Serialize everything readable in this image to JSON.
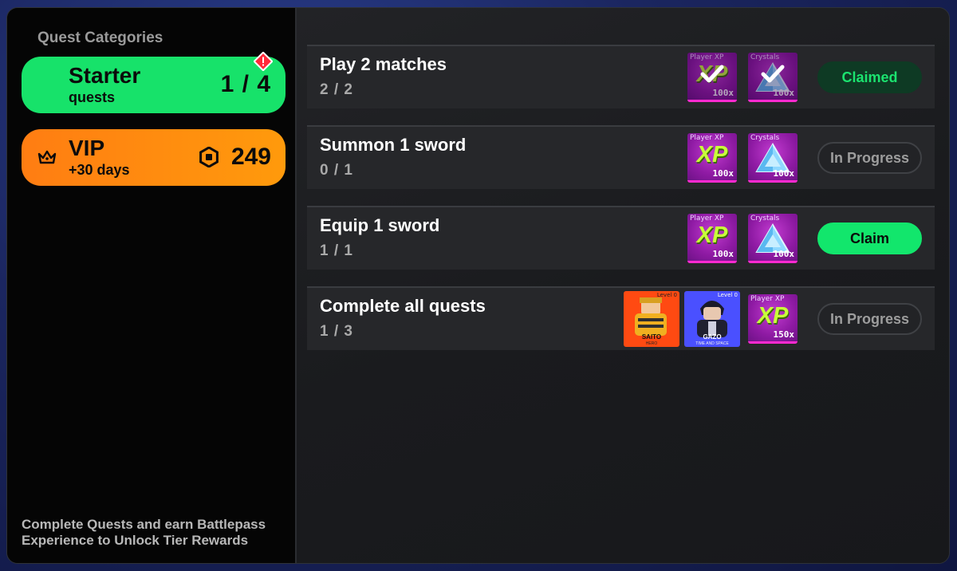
{
  "sidebar": {
    "title": "Quest Categories",
    "categories": [
      {
        "title": "Starter",
        "subtitle": "quests",
        "count": "1 / 4",
        "icon": "alert-icon"
      },
      {
        "title": "VIP",
        "subtitle": "+30 days",
        "amount": "249",
        "icon": "crown-icon",
        "currency_icon": "robux-icon"
      }
    ],
    "footer": "Complete Quests and earn Battlepass Experience to Unlock Tier Rewards"
  },
  "quests": [
    {
      "title": "Play 2 matches",
      "progress": "2 / 2",
      "button": "Claimed",
      "state": "claimed",
      "rewards": [
        {
          "type": "xp",
          "label": "Player XP",
          "xp_text": "XP",
          "amount": "100x",
          "claimed": true
        },
        {
          "type": "crystal",
          "label": "Crystals",
          "amount": "100x",
          "claimed": true
        }
      ]
    },
    {
      "title": "Summon 1 sword",
      "progress": "0 / 1",
      "button": "In Progress",
      "state": "in-progress",
      "rewards": [
        {
          "type": "xp",
          "label": "Player XP",
          "xp_text": "XP",
          "amount": "100x"
        },
        {
          "type": "crystal",
          "label": "Crystals",
          "amount": "100x"
        }
      ]
    },
    {
      "title": "Equip 1 sword",
      "progress": "1 / 1",
      "button": "Claim",
      "state": "claimable",
      "rewards": [
        {
          "type": "xp",
          "label": "Player XP",
          "xp_text": "XP",
          "amount": "100x"
        },
        {
          "type": "crystal",
          "label": "Crystals",
          "amount": "100x"
        }
      ]
    },
    {
      "title": "Complete all quests",
      "progress": "1 / 3",
      "button": "In Progress",
      "state": "in-progress",
      "rewards": [
        {
          "type": "hero",
          "level": "Level 0",
          "name": "SAITO",
          "tag": "HERO"
        },
        {
          "type": "hero",
          "level": "Level 0",
          "name": "GAZO",
          "tag": "TIME AND SPACE"
        },
        {
          "type": "xp",
          "label": "Player XP",
          "xp_text": "XP",
          "amount": "150x"
        }
      ]
    }
  ],
  "colors": {
    "starter_green": "#17e26a",
    "vip_orange": "#ff8a10",
    "claim_green": "#12e66c",
    "claimed_bg": "#0e3a24",
    "reward_purple": "#9b24b0"
  }
}
